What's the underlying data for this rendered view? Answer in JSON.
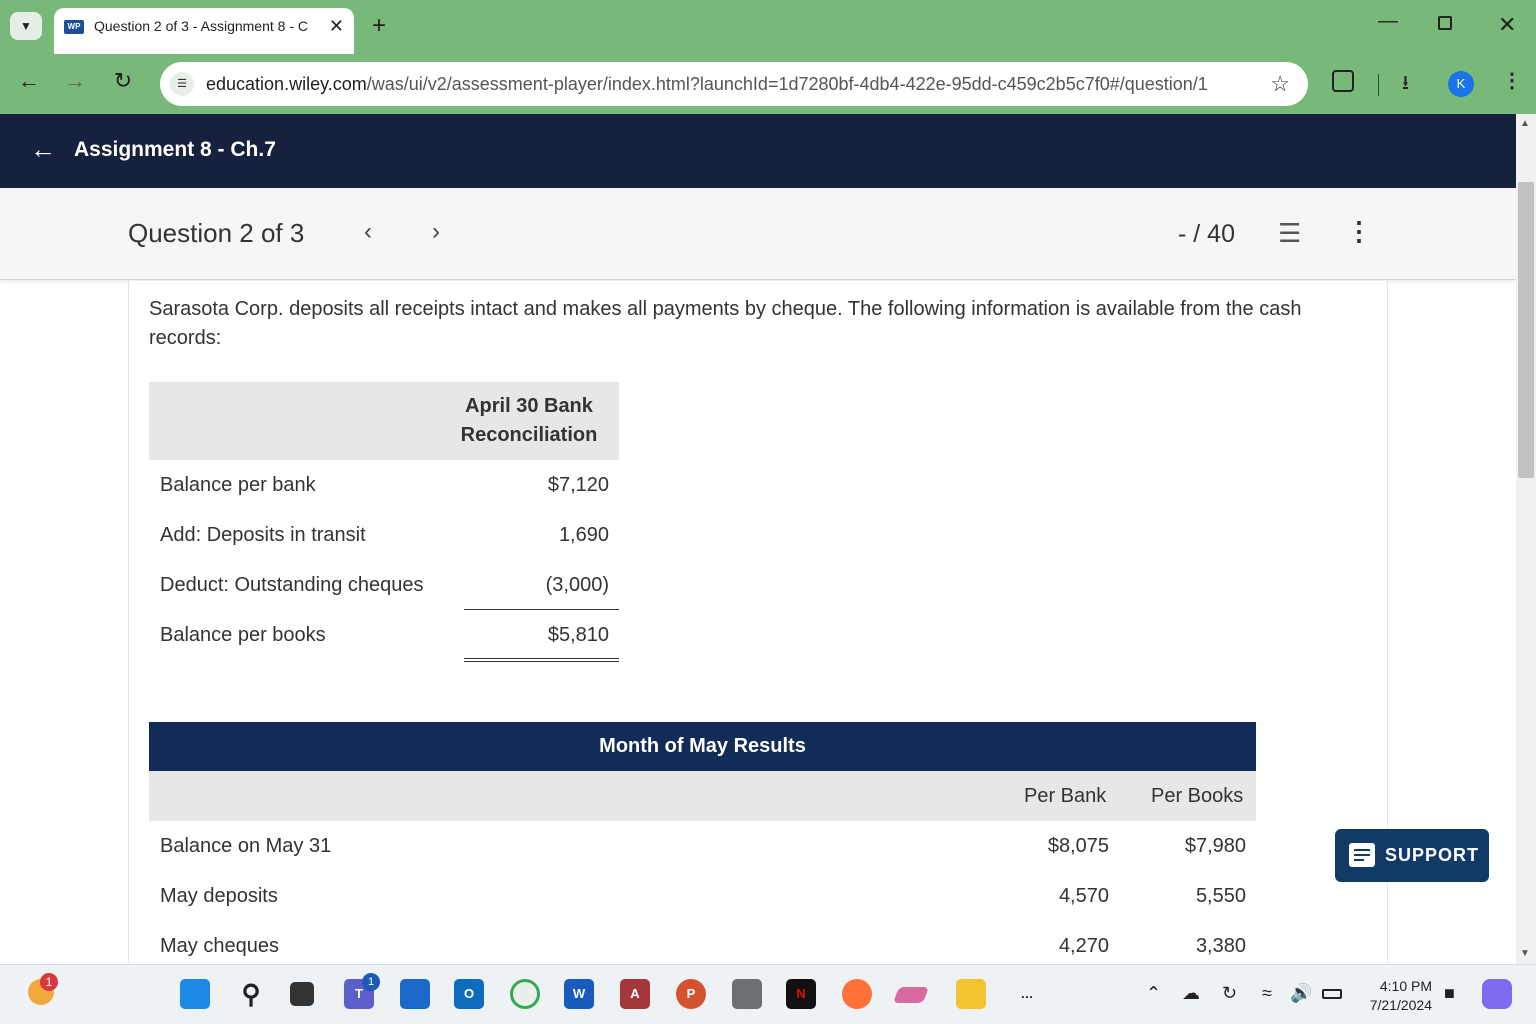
{
  "browser": {
    "tab_title": "Question 2 of 3 - Assignment 8 - C",
    "favicon_text": "WP",
    "url_host": "education.wiley.com",
    "url_path": "/was/ui/v2/assessment-player/index.html?launchId=1d7280bf-4db4-422e-95dd-c459c2b5c7f0#/question/1",
    "avatar_letter": "K"
  },
  "app": {
    "back_label": "Assignment 8 - Ch.7",
    "question_label": "Question 2 of 3",
    "score": "- / 40"
  },
  "question": {
    "intro": "Sarasota Corp. deposits all receipts intact and makes all payments by cheque. The following information is available from the cash records:",
    "reconciliation": {
      "header_line1": "April 30 Bank",
      "header_line2": "Reconciliation",
      "rows": [
        {
          "label": "Balance per bank",
          "value": "$7,120"
        },
        {
          "label": "Add: Deposits in transit",
          "value": "1,690"
        },
        {
          "label": "Deduct: Outstanding cheques",
          "value": "(3,000)"
        },
        {
          "label": "Balance per books",
          "value": "$5,810"
        }
      ]
    },
    "may": {
      "title": "Month of May Results",
      "col1": "Per Bank",
      "col2": "Per Books",
      "rows": [
        {
          "label": "Balance on May 31",
          "bank": "$8,075",
          "books": "$7,980"
        },
        {
          "label": "May deposits",
          "bank": "4,570",
          "books": "5,550"
        },
        {
          "label": "May cheques",
          "bank": "4,270",
          "books": "3,380"
        }
      ]
    }
  },
  "support_label": "SUPPORT",
  "taskbar": {
    "time": "4:10 PM",
    "date": "7/21/2024",
    "weather_badge": "1",
    "teams_badge": "1"
  },
  "colors": {
    "chrome_green": "#78b97a",
    "header_navy": "#16213e",
    "table_banner": "#122b57",
    "support_btn": "#123a66"
  }
}
